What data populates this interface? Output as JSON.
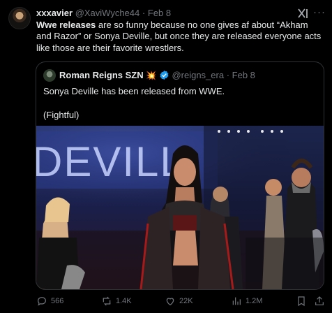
{
  "post": {
    "display_name": "xxxavier",
    "handle": "@XaviWyche44",
    "separator": "·",
    "date": "Feb 8",
    "text_bold": "Wwe releases",
    "text_rest": " are so funny because no one gives af about “Akham and Razor” or Sonya Deville, but once they are released everyone acts like those are their favorite wrestlers."
  },
  "quote": {
    "display_name": "Roman Reigns SZN",
    "handle": "@reigns_era",
    "separator": "·",
    "date": "Feb 8",
    "line1": "Sonya Deville has been released from WWE.",
    "line2": "(Fightful)",
    "photo_banner_text": "DEVILL"
  },
  "actions": {
    "replies": "566",
    "reposts": "1.4K",
    "likes": "22K",
    "views": "1.2M"
  },
  "colors": {
    "background": "#000000",
    "text": "#e7e9ea",
    "muted": "#71767b",
    "verified": "#1d9bf0",
    "border": "#2f3336"
  },
  "icons": [
    "grok-icon",
    "more-icon",
    "verified-badge-icon",
    "reply-icon",
    "repost-icon",
    "like-icon",
    "views-icon",
    "bookmark-icon",
    "share-icon"
  ]
}
